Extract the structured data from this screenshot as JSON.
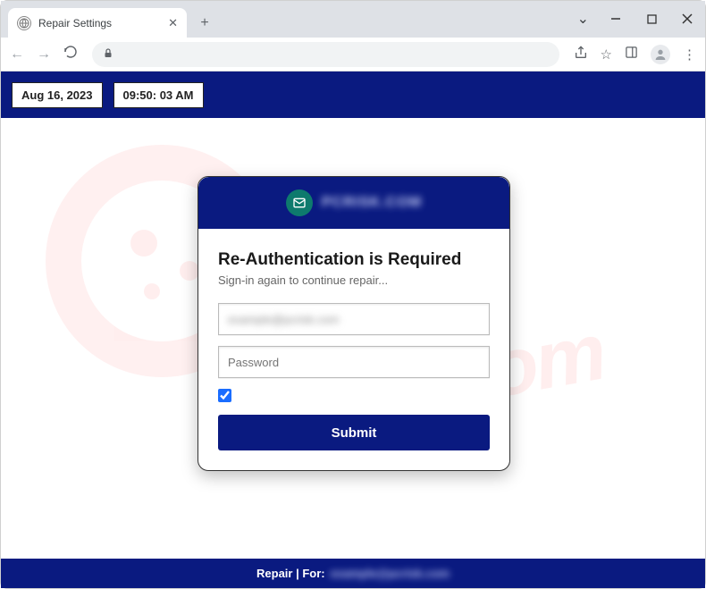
{
  "browser": {
    "tab_title": "Repair Settings",
    "chevron": "⌄"
  },
  "header": {
    "date": "Aug 16, 2023",
    "time": "09:50: 03 AM"
  },
  "card": {
    "head_label": "PCRISK.COM",
    "title": "Re-Authentication is Required",
    "subtitle": "Sign-in again to continue repair...",
    "email_value": "example@pcrisk.com",
    "password_placeholder": "Password",
    "checkbox_checked": true,
    "submit_label": "Submit"
  },
  "footer": {
    "left": "Repair | For:",
    "right": "example@pcrisk.com"
  },
  "colors": {
    "brand_navy": "#0a1a80",
    "accent_teal": "#0e7a6d"
  }
}
